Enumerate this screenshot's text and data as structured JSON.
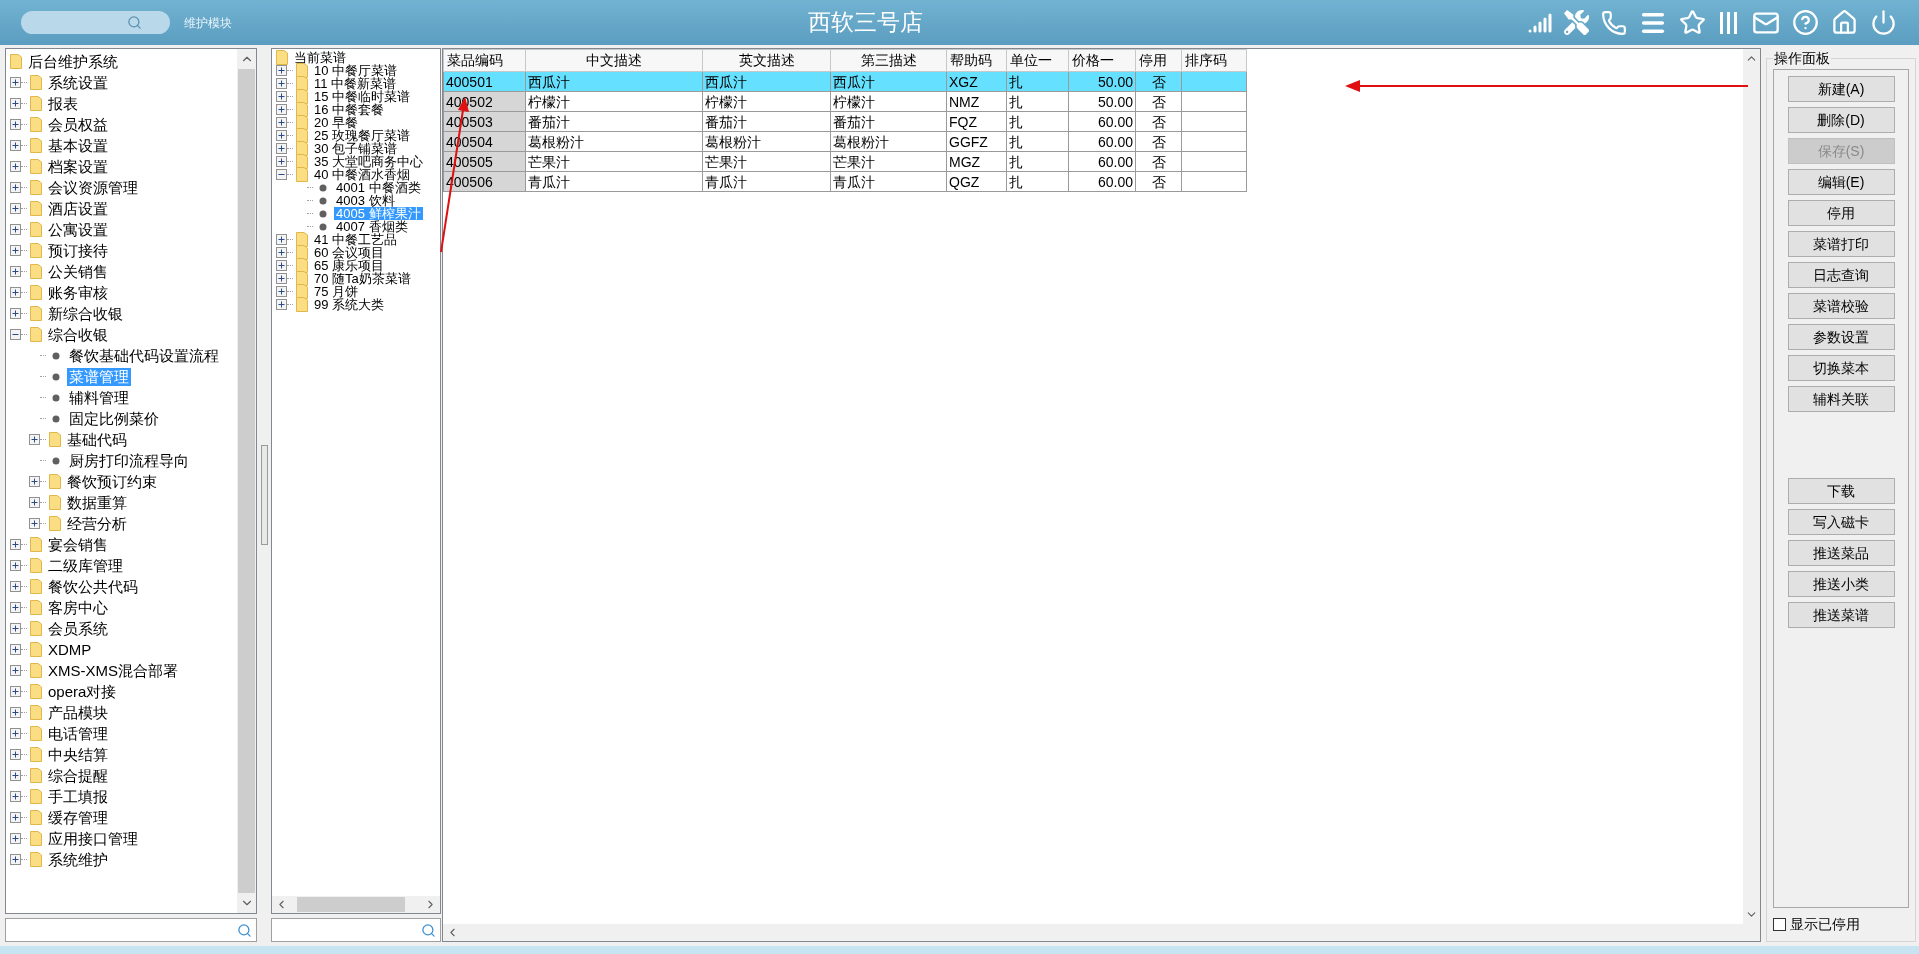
{
  "header": {
    "module_label": "维护模块",
    "title": "西软三号店"
  },
  "nav_tree": {
    "kind": "root",
    "label": "后台维护系统",
    "selected": false,
    "children": [
      {
        "kind": "folder",
        "label": "系统设置",
        "expanded": false,
        "selected": false
      },
      {
        "kind": "folder",
        "label": "报表",
        "expanded": false,
        "selected": false
      },
      {
        "kind": "folder",
        "label": "会员权益",
        "expanded": false,
        "selected": false
      },
      {
        "kind": "folder",
        "label": "基本设置",
        "expanded": false,
        "selected": false
      },
      {
        "kind": "folder",
        "label": "档案设置",
        "expanded": false,
        "selected": false
      },
      {
        "kind": "folder",
        "label": "会议资源管理",
        "expanded": false,
        "selected": false
      },
      {
        "kind": "folder",
        "label": "酒店设置",
        "expanded": false,
        "selected": false
      },
      {
        "kind": "folder",
        "label": "公寓设置",
        "expanded": false,
        "selected": false
      },
      {
        "kind": "folder",
        "label": "预订接待",
        "expanded": false,
        "selected": false
      },
      {
        "kind": "folder",
        "label": "公关销售",
        "expanded": false,
        "selected": false
      },
      {
        "kind": "folder",
        "label": "账务审核",
        "expanded": false,
        "selected": false
      },
      {
        "kind": "folder",
        "label": "新综合收银",
        "expanded": false,
        "selected": false
      },
      {
        "kind": "folder",
        "label": "综合收银",
        "expanded": true,
        "selected": false,
        "children": [
          {
            "kind": "leaf",
            "label": "餐饮基础代码设置流程",
            "selected": false
          },
          {
            "kind": "leaf",
            "label": "菜谱管理",
            "selected": true
          },
          {
            "kind": "leaf",
            "label": "辅料管理",
            "selected": false
          },
          {
            "kind": "leaf",
            "label": "固定比例菜价",
            "selected": false
          },
          {
            "kind": "folder",
            "label": "基础代码",
            "expanded": false,
            "selected": false
          },
          {
            "kind": "leaf",
            "label": "厨房打印流程导向",
            "selected": false
          },
          {
            "kind": "folder",
            "label": "餐饮预订约束",
            "expanded": false,
            "selected": false
          },
          {
            "kind": "folder",
            "label": "数据重算",
            "expanded": false,
            "selected": false
          },
          {
            "kind": "folder",
            "label": "经营分析",
            "expanded": false,
            "selected": false
          }
        ]
      },
      {
        "kind": "folder",
        "label": "宴会销售",
        "expanded": false,
        "selected": false
      },
      {
        "kind": "folder",
        "label": "二级库管理",
        "expanded": false,
        "selected": false
      },
      {
        "kind": "folder",
        "label": "餐饮公共代码",
        "expanded": false,
        "selected": false
      },
      {
        "kind": "folder",
        "label": "客房中心",
        "expanded": false,
        "selected": false
      },
      {
        "kind": "folder",
        "label": "会员系统",
        "expanded": false,
        "selected": false
      },
      {
        "kind": "folder",
        "label": "XDMP",
        "expanded": false,
        "selected": false
      },
      {
        "kind": "folder",
        "label": "XMS-XMS混合部署",
        "expanded": false,
        "selected": false
      },
      {
        "kind": "folder",
        "label": "opera对接",
        "expanded": false,
        "selected": false
      },
      {
        "kind": "folder",
        "label": "产品模块",
        "expanded": false,
        "selected": false
      },
      {
        "kind": "folder",
        "label": "电话管理",
        "expanded": false,
        "selected": false
      },
      {
        "kind": "folder",
        "label": "中央结算",
        "expanded": false,
        "selected": false
      },
      {
        "kind": "folder",
        "label": "综合提醒",
        "expanded": false,
        "selected": false
      },
      {
        "kind": "folder",
        "label": "手工填报",
        "expanded": false,
        "selected": false
      },
      {
        "kind": "folder",
        "label": "缓存管理",
        "expanded": false,
        "selected": false
      },
      {
        "kind": "folder",
        "label": "应用接口管理",
        "expanded": false,
        "selected": false
      },
      {
        "kind": "folder",
        "label": "系统维护",
        "expanded": false,
        "selected": false
      }
    ]
  },
  "menu_tree": {
    "kind": "root",
    "label": "当前菜谱",
    "selected": false,
    "children": [
      {
        "kind": "folder",
        "label": "10 中餐厅菜谱",
        "expanded": false,
        "selected": false
      },
      {
        "kind": "folder",
        "label": "11 中餐新菜谱",
        "expanded": false,
        "selected": false
      },
      {
        "kind": "folder",
        "label": "15 中餐临时菜谱",
        "expanded": false,
        "selected": false
      },
      {
        "kind": "folder",
        "label": "16 中餐套餐",
        "expanded": false,
        "selected": false
      },
      {
        "kind": "folder",
        "label": "20 早餐",
        "expanded": false,
        "selected": false
      },
      {
        "kind": "folder",
        "label": "25 玫瑰餐厅菜谱",
        "expanded": false,
        "selected": false
      },
      {
        "kind": "folder",
        "label": "30 包子铺菜谱",
        "expanded": false,
        "selected": false
      },
      {
        "kind": "folder",
        "label": "35 大堂吧商务中心",
        "expanded": false,
        "selected": false
      },
      {
        "kind": "folder",
        "label": "40 中餐酒水香烟",
        "expanded": true,
        "selected": false,
        "children": [
          {
            "kind": "leaf",
            "label": "4001 中餐酒类",
            "selected": false
          },
          {
            "kind": "leaf",
            "label": "4003 饮料",
            "selected": false
          },
          {
            "kind": "leaf",
            "label": "4005 鲜榨果汁",
            "selected": true
          },
          {
            "kind": "leaf",
            "label": "4007 香烟类",
            "selected": false
          }
        ]
      },
      {
        "kind": "folder",
        "label": "41 中餐工艺品",
        "expanded": false,
        "selected": false
      },
      {
        "kind": "folder",
        "label": "60 会议项目",
        "expanded": false,
        "selected": false
      },
      {
        "kind": "folder",
        "label": "65 康乐项目",
        "expanded": false,
        "selected": false
      },
      {
        "kind": "folder",
        "label": "70 随Ta奶茶菜谱",
        "expanded": false,
        "selected": false
      },
      {
        "kind": "folder",
        "label": "75 月饼",
        "expanded": false,
        "selected": false
      },
      {
        "kind": "folder",
        "label": "99 系统大类",
        "expanded": false,
        "selected": false
      }
    ]
  },
  "table": {
    "columns": [
      "菜品编码",
      "中文描述",
      "英文描述",
      "第三描述",
      "帮助码",
      "单位一",
      "价格一",
      "停用",
      "排序码"
    ],
    "rows": [
      {
        "selected": true,
        "cells": [
          "400501",
          "西瓜汁",
          "西瓜汁",
          "西瓜汁",
          "XGZ",
          "扎",
          "50.00",
          "否"
        ]
      },
      {
        "selected": false,
        "cells": [
          "400502",
          "柠檬汁",
          "柠檬汁",
          "柠檬汁",
          "NMZ",
          "扎",
          "50.00",
          "否"
        ]
      },
      {
        "selected": false,
        "cells": [
          "400503",
          "番茄汁",
          "番茄汁",
          "番茄汁",
          "FQZ",
          "扎",
          "60.00",
          "否"
        ]
      },
      {
        "selected": false,
        "cells": [
          "400504",
          "葛根粉汁",
          "葛根粉汁",
          "葛根粉汁",
          "GGFZ",
          "扎",
          "60.00",
          "否"
        ]
      },
      {
        "selected": false,
        "cells": [
          "400505",
          "芒果汁",
          "芒果汁",
          "芒果汁",
          "MGZ",
          "扎",
          "60.00",
          "否"
        ]
      },
      {
        "selected": false,
        "cells": [
          "400506",
          "青瓜汁",
          "青瓜汁",
          "青瓜汁",
          "QGZ",
          "扎",
          "60.00",
          "否"
        ]
      }
    ]
  },
  "panel": {
    "title": "操作面板",
    "button_groups": [
      [
        {
          "label": "新建(A)",
          "disabled": false
        },
        {
          "label": "删除(D)",
          "disabled": false
        },
        {
          "label": "保存(S)",
          "disabled": true
        },
        {
          "label": "编辑(E)",
          "disabled": false
        },
        {
          "label": "停用",
          "disabled": false
        },
        {
          "label": "菜谱打印",
          "disabled": false
        },
        {
          "label": "日志查询",
          "disabled": false
        },
        {
          "label": "菜谱校验",
          "disabled": false
        },
        {
          "label": "参数设置",
          "disabled": false
        },
        {
          "label": "切换菜本",
          "disabled": false
        },
        {
          "label": "辅料关联",
          "disabled": false
        }
      ],
      [
        {
          "label": "下载",
          "disabled": false
        },
        {
          "label": "写入磁卡",
          "disabled": false
        },
        {
          "label": "推送菜品",
          "disabled": false
        },
        {
          "label": "推送小类",
          "disabled": false
        },
        {
          "label": "推送菜谱",
          "disabled": false
        }
      ]
    ],
    "show_disabled": {
      "label": "显示已停用",
      "checked": false
    }
  }
}
